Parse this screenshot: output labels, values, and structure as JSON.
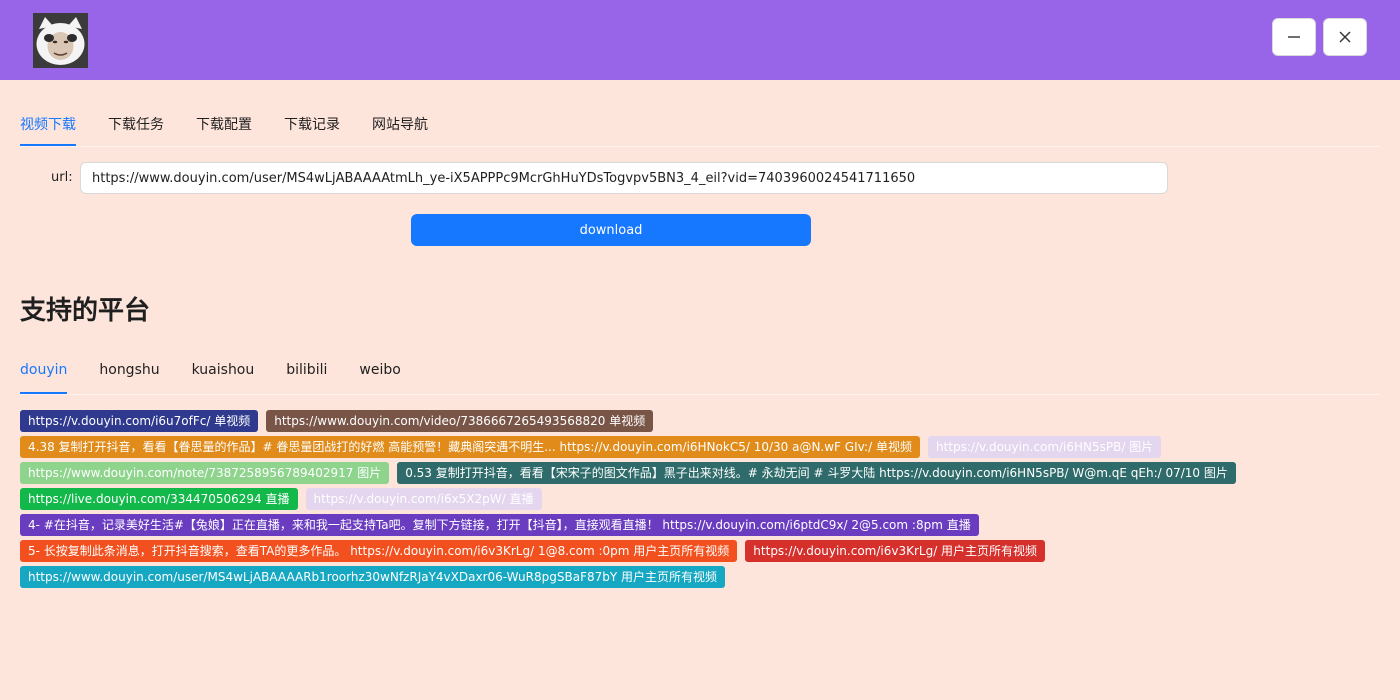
{
  "header": {
    "avatar_icon": "panda-meme-avatar-icon",
    "minimize_icon": "minimize-icon",
    "close_icon": "close-icon"
  },
  "main_tabs": [
    "视频下载",
    "下载任务",
    "下载配置",
    "下载记录",
    "网站导航"
  ],
  "form": {
    "url_label": "url:",
    "url_value": "https://www.douyin.com/user/MS4wLjABAAAAtmLh_ye-iX5APPPc9McrGhHuYDsTogvpv5BN3_4_eil?vid=7403960024541711650",
    "download_label": "download"
  },
  "section_title": "支持的平台",
  "platform_tabs": [
    "douyin",
    "hongshu",
    "kuaishou",
    "bilibili",
    "weibo"
  ],
  "tag_rows": [
    [
      {
        "text": "https://v.douyin.com/i6u7ofFc/ 单视频",
        "color": "#2f3a8f"
      },
      {
        "text": "https://www.douyin.com/video/7386667265493568820 单视频",
        "color": "#795548"
      }
    ],
    [
      {
        "text": "4.38 复制打开抖音，看看【眷思量的作品】# 眷思量团战打的好燃 高能预警！藏典阁突遇不明生... https://v.douyin.com/i6HNokC5/ 10/30 a@N.wF GIv:/ 单视频",
        "color": "#e08b1a"
      },
      {
        "text": "https://v.douyin.com/i6HN5sPB/ 图片",
        "color": "#e3d6ee"
      }
    ],
    [
      {
        "text": "https://www.douyin.com/note/7387258956789402917 图片",
        "color": "#8ed48d"
      },
      {
        "text": "0.53 复制打开抖音，看看【宋宋子的图文作品】黑子出来对线。# 永劫无间 # 斗罗大陆 https://v.douyin.com/i6HN5sPB/ W@m.qE qEh:/ 07/10 图片",
        "color": "#2e6b6a"
      }
    ],
    [
      {
        "text": "https://live.douyin.com/334470506294 直播",
        "color": "#12b84a"
      },
      {
        "text": "https://v.douyin.com/i6x5X2pW/ 直播",
        "color": "#e3d6ee"
      }
    ],
    [
      {
        "text": "4- #在抖音，记录美好生活#【兔娘】正在直播，来和我一起支持Ta吧。复制下方链接，打开【抖音】，直接观看直播！ https://v.douyin.com/i6ptdC9x/ 2@5.com :8pm 直播",
        "color": "#6a3cc0"
      }
    ],
    [
      {
        "text": "5- 长按复制此条消息，打开抖音搜索，查看TA的更多作品。 https://v.douyin.com/i6v3KrLg/ 1@8.com :0pm 用户主页所有视频",
        "color": "#f2511f"
      },
      {
        "text": "https://v.douyin.com/i6v3KrLg/ 用户主页所有视频",
        "color": "#d6302c"
      }
    ],
    [
      {
        "text": "https://www.douyin.com/user/MS4wLjABAAAARb1roorhz30wNfzRJaY4vXDaxr06-WuR8pgSBaF87bY 用户主页所有视频",
        "color": "#16a7c2"
      }
    ]
  ]
}
